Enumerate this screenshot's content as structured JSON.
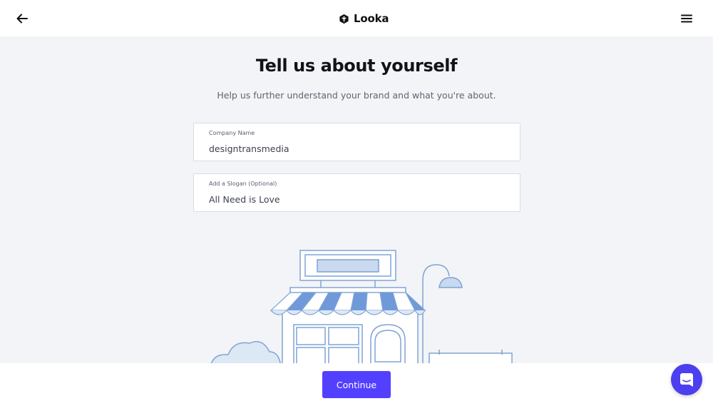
{
  "header": {
    "back_icon": "arrow-left-icon",
    "brand_name": "Looka",
    "menu_icon": "hamburger-menu-icon"
  },
  "main": {
    "title": "Tell us about yourself",
    "subtitle": "Help us further understand your brand and what you're about.",
    "company_field": {
      "label": "Company Name",
      "value": "designtransmedia"
    },
    "slogan_field": {
      "label": "Add a Slogan (Optional)",
      "value": "All Need is Love"
    },
    "illustration": "storefront-illustration"
  },
  "footer": {
    "continue_label": "Continue"
  },
  "chat": {
    "icon": "chat-icon"
  },
  "colors": {
    "accent": "#5340ff",
    "background": "#f3f4f7",
    "illustration_line": "#7fa3d6",
    "illustration_fill": "#dde8f5"
  }
}
